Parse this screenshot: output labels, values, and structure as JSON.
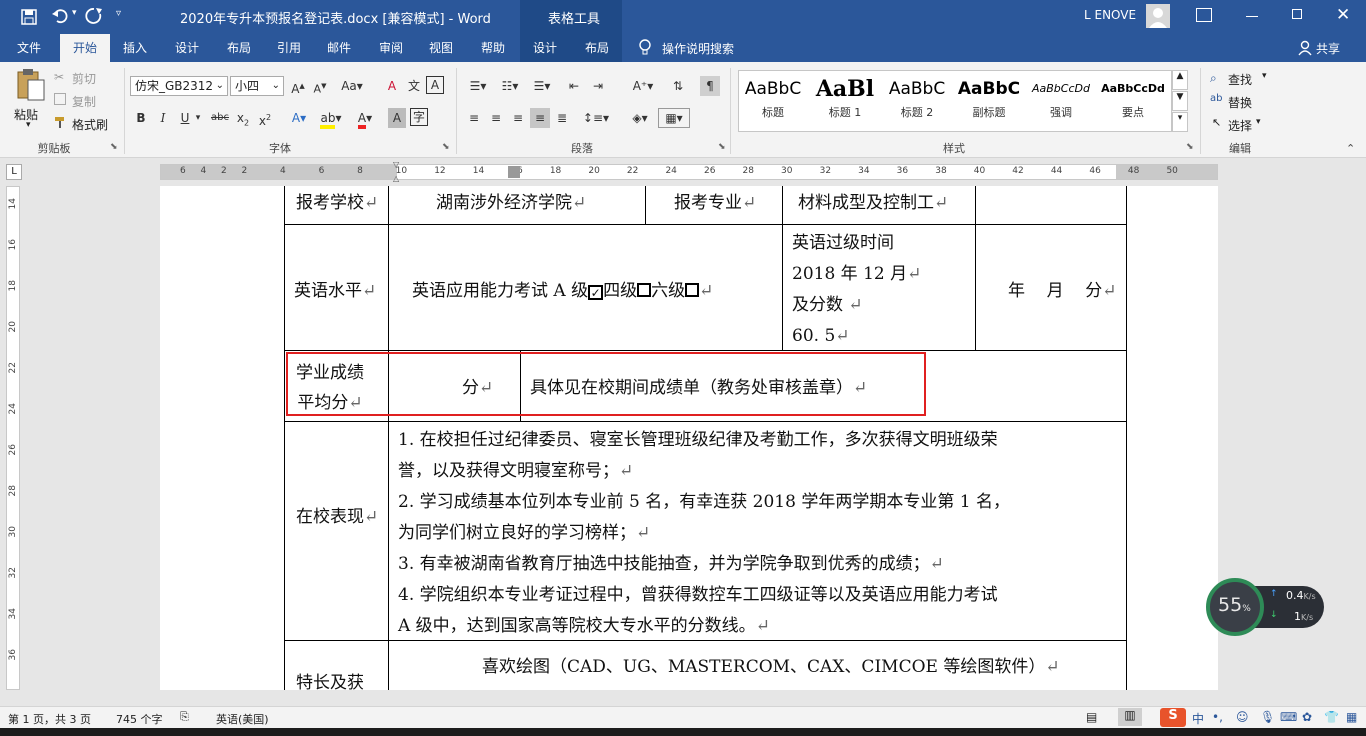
{
  "titlebar": {
    "doc_title": "2020年专升本预报名登记表.docx [兼容模式]  -  Word",
    "context_tab": "表格工具",
    "user": "L ENOVE",
    "save_icon": "save-icon",
    "undo_icon": "undo-icon",
    "redo_icon": "redo-icon"
  },
  "tabs": [
    "文件",
    "开始",
    "插入",
    "设计",
    "布局",
    "引用",
    "邮件",
    "审阅",
    "视图",
    "帮助",
    "设计",
    "布局"
  ],
  "tell_me": "操作说明搜索",
  "share": "共享",
  "ribbon": {
    "clipboard": {
      "paste": "粘贴",
      "cut": "剪切",
      "copy": "复制",
      "format_painter": "格式刷",
      "label": "剪贴板"
    },
    "font": {
      "font_name": "仿宋_GB2312",
      "font_size": "小四",
      "label": "字体"
    },
    "paragraph": {
      "label": "段落"
    },
    "styles": {
      "label": "样式",
      "items": [
        {
          "sample": "AaBbC",
          "name": "标题"
        },
        {
          "sample": "AaBl",
          "name": "标题 1"
        },
        {
          "sample": "AaBbC",
          "name": "标题 2"
        },
        {
          "sample": "AaBbC",
          "name": "副标题"
        },
        {
          "sample": "AaBbCcDd",
          "name": "强调"
        },
        {
          "sample": "AaBbCcDd",
          "name": "要点"
        }
      ]
    },
    "editing": {
      "find": "查找",
      "replace": "替换",
      "select": "选择",
      "label": "编辑"
    }
  },
  "ruler": {
    "ticks": [
      "6",
      "4",
      "2",
      "2",
      "4",
      "6",
      "8",
      "10",
      "12",
      "14",
      "16",
      "18",
      "20",
      "22",
      "24",
      "26",
      "28",
      "30",
      "32",
      "34",
      "36",
      "38",
      "40",
      "42",
      "44",
      "46",
      "48",
      "50"
    ]
  },
  "vruler": {
    "ticks": [
      "14",
      "16",
      "18",
      "20",
      "22",
      "24",
      "26",
      "28",
      "30",
      "32",
      "34",
      "36"
    ]
  },
  "table": {
    "r1": {
      "a": "报考学校",
      "b": "湖南涉外经济学院",
      "c": "报考专业",
      "d": "材料成型及控制工"
    },
    "r2": {
      "a": "英语水平",
      "b_pre": "英语应用能力考试 A 级",
      "b_lv4": "四级",
      "b_lv6": "六级",
      "c1": "英语过级时间",
      "c2": "2018 年 12 月",
      "c3": "及分数",
      "c4": "60. 5",
      "d": "年    月    分"
    },
    "r3": {
      "a1": "学业成绩",
      "a2": "平均分",
      "b": "分",
      "c": "具体见在校期间成绩单（教务处审核盖章）"
    },
    "r4": {
      "a": "在校表现",
      "lines": [
        "1. 在校担任过纪律委员、寝室长管理班级纪律及考勤工作，多次获得文明班级荣",
        "誉，以及获得文明寝室称号；",
        "2. 学习成绩基本位列本专业前 5 名，有幸连获 2018 学年两学期本专业第 1 名，",
        "为同学们树立良好的学习榜样；",
        "3. 有幸被湖南省教育厅抽选中技能抽查，并为学院争取到优秀的成绩；",
        "4. 学院组织本专业考证过程中，曾获得数控车工四级证等以及英语应用能力考试",
        "A 级中，达到国家高等院校大专水平的分数线。"
      ]
    },
    "r5": {
      "a": "特长及获",
      "b": "喜欢绘图（CAD、UG、MASTERCOM、CAX、CIMCOE 等绘图软件）"
    }
  },
  "para_mark": "↵",
  "widget": {
    "percent": "55",
    "percent_sign": "%",
    "up": "0.4",
    "up_unit": "K/s",
    "down": "1",
    "down_unit": "K/s"
  },
  "status": {
    "page": "第 1 页，共 3 页",
    "words": "745 个字",
    "lang": "英语(美国)"
  }
}
